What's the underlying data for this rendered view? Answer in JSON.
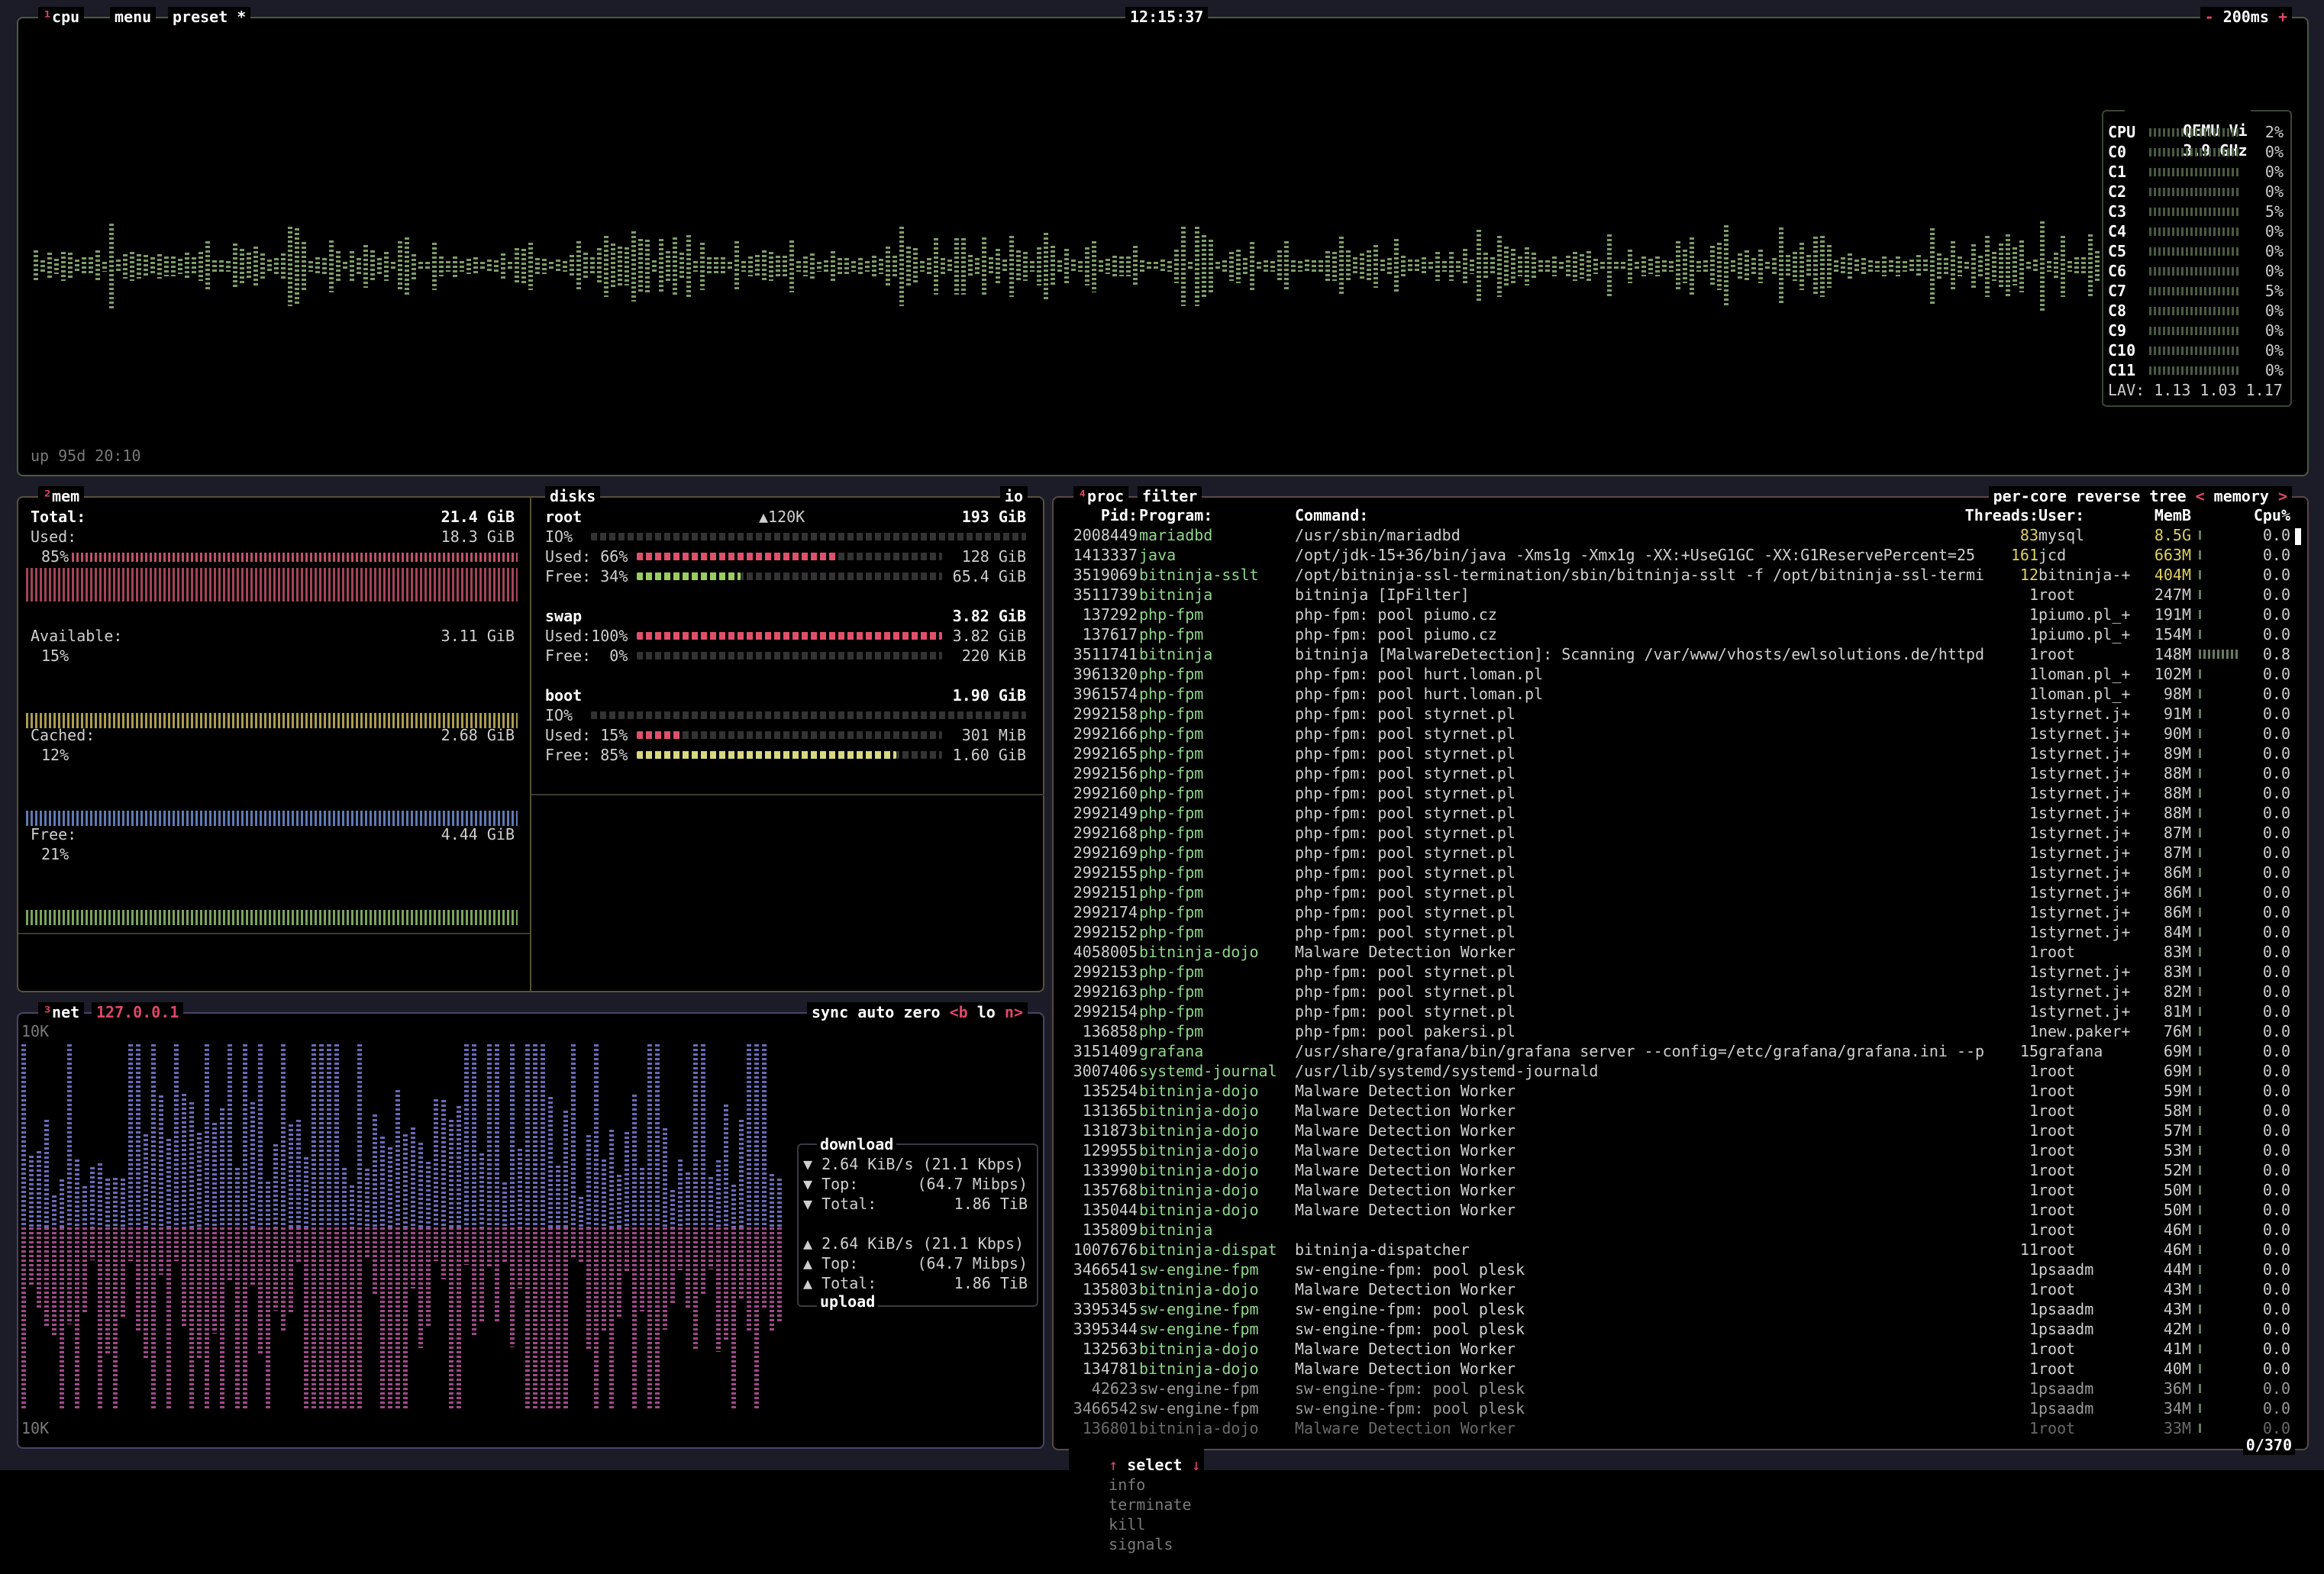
{
  "cpu": {
    "title_prefix": "¹",
    "title": "cpu",
    "menu": "menu",
    "preset": "preset *",
    "time": "12:15:37",
    "interval": "200ms",
    "minus": "-",
    "plus": "+",
    "uptime": "up 95d 20:10",
    "model": "QEMU Vi",
    "freq": "3.9 GHz",
    "total_label": "CPU",
    "total_pct": "2%",
    "cores": [
      {
        "label": "C0",
        "pct": "0%"
      },
      {
        "label": "C1",
        "pct": "0%"
      },
      {
        "label": "C2",
        "pct": "0%"
      },
      {
        "label": "C3",
        "pct": "5%"
      },
      {
        "label": "C4",
        "pct": "0%"
      },
      {
        "label": "C5",
        "pct": "0%"
      },
      {
        "label": "C6",
        "pct": "0%"
      },
      {
        "label": "C7",
        "pct": "5%"
      },
      {
        "label": "C8",
        "pct": "0%"
      },
      {
        "label": "C9",
        "pct": "0%"
      },
      {
        "label": "C10",
        "pct": "0%"
      },
      {
        "label": "C11",
        "pct": "0%"
      }
    ],
    "lav": "LAV: 1.13 1.03 1.17"
  },
  "mem": {
    "title_prefix": "²",
    "title": "mem",
    "total_label": "Total:",
    "total": "21.4 GiB",
    "used_label": "Used:",
    "used": "18.3 GiB",
    "used_pct": "85%",
    "avail_label": "Available:",
    "avail": "3.11 GiB",
    "avail_pct": "15%",
    "cached_label": "Cached:",
    "cached": "2.68 GiB",
    "cached_pct": "12%",
    "free_label": "Free:",
    "free": "4.44 GiB",
    "free_pct": "21%"
  },
  "disks": {
    "title": "disks",
    "io": "io",
    "root": {
      "name": "root",
      "speed": "▲120K",
      "size": "193 GiB",
      "io": "IO%",
      "used_label": "Used: 66%",
      "used": "128 GiB",
      "used_frac": 0.66,
      "free_label": "Free: 34%",
      "free": "65.4 GiB",
      "free_frac": 0.34
    },
    "swap": {
      "name": "swap",
      "size": "3.82 GiB",
      "used_label": "Used:100%",
      "used": "3.82 GiB",
      "used_frac": 1.0,
      "free_label": "Free:  0%",
      "free": "220 KiB",
      "free_frac": 0.0
    },
    "boot": {
      "name": "boot",
      "size": "1.90 GiB",
      "io": "IO%",
      "used_label": "Used: 15%",
      "used": "301 MiB",
      "used_frac": 0.15,
      "free_label": "Free: 85%",
      "free": "1.60 GiB",
      "free_frac": 0.85
    }
  },
  "net": {
    "title_prefix": "³",
    "title": "net",
    "iface": "127.0.0.1",
    "sync": "sync",
    "auto": "auto",
    "zero": "zero",
    "b": "<b",
    "lo": "lo",
    "n": "n>",
    "scale_top": "10K",
    "scale_bottom": "10K",
    "download_label": "download",
    "dl_rate": "2.64 KiB/s",
    "dl_rate_bits": "(21.1 Kbps)",
    "dl_top_label": "Top:",
    "dl_top": "(64.7 Mibps)",
    "dl_total_label": "Total:",
    "dl_total": "1.86 TiB",
    "ul_rate": "2.64 KiB/s",
    "ul_rate_bits": "(21.1 Kbps)",
    "ul_top_label": "Top:",
    "ul_top": "(64.7 Mibps)",
    "ul_total_label": "Total:",
    "ul_total": "1.86 TiB",
    "upload_label": "upload"
  },
  "proc": {
    "title_prefix": "⁴",
    "title": "proc",
    "filter": "filter",
    "per_core": "per-core",
    "reverse": "reverse",
    "tree": "tree",
    "sort": "memory",
    "headers": {
      "pid": "Pid:",
      "program": "Program:",
      "command": "Command:",
      "threads": "Threads:",
      "user": "User:",
      "memb": "MemB",
      "cpu": "Cpu%"
    },
    "footer_select": "select",
    "footer_info": "info",
    "footer_terminate": "terminate",
    "footer_kill": "kill",
    "footer_signals": "signals",
    "count": "0/370",
    "rows": [
      {
        "pid": "2008449",
        "prog": "mariadbd",
        "cmd": "/usr/sbin/mariadbd",
        "thr": "83",
        "user": "mysql",
        "mem": "8.5G",
        "cpu": "0.0",
        "load": 0.02
      },
      {
        "pid": "1413337",
        "prog": "java",
        "cmd": "/opt/jdk-15+36/bin/java -Xms1g -Xmx1g -XX:+UseG1GC -XX:G1ReservePercent=25",
        "thr": "161",
        "user": "jcd",
        "mem": "663M",
        "cpu": "0.0",
        "load": 0.02
      },
      {
        "pid": "3519069",
        "prog": "bitninja-sslt",
        "cmd": "/opt/bitninja-ssl-termination/sbin/bitninja-sslt -f /opt/bitninja-ssl-termi",
        "thr": "12",
        "user": "bitninja-+",
        "mem": "404M",
        "cpu": "0.0",
        "load": 0.1
      },
      {
        "pid": "3511739",
        "prog": "bitninja",
        "cmd": "bitninja [IpFilter]",
        "thr": "1",
        "user": "root",
        "mem": "247M",
        "cpu": "0.0",
        "load": 0.02
      },
      {
        "pid": "137292",
        "prog": "php-fpm",
        "cmd": "php-fpm: pool piumo.cz",
        "thr": "1",
        "user": "piumo.pl_+",
        "mem": "191M",
        "cpu": "0.0",
        "load": 0.02
      },
      {
        "pid": "137617",
        "prog": "php-fpm",
        "cmd": "php-fpm: pool piumo.cz",
        "thr": "1",
        "user": "piumo.pl_+",
        "mem": "154M",
        "cpu": "0.0",
        "load": 0.02
      },
      {
        "pid": "3511741",
        "prog": "bitninja",
        "cmd": "bitninja [MalwareDetection]: Scanning /var/www/vhosts/ewlsolutions.de/httpd",
        "thr": "1",
        "user": "root",
        "mem": "148M",
        "cpu": "0.8",
        "load": 0.9
      },
      {
        "pid": "3961320",
        "prog": "php-fpm",
        "cmd": "php-fpm: pool hurt.loman.pl",
        "thr": "1",
        "user": "loman.pl_+",
        "mem": "102M",
        "cpu": "0.0",
        "load": 0.02
      },
      {
        "pid": "3961574",
        "prog": "php-fpm",
        "cmd": "php-fpm: pool hurt.loman.pl",
        "thr": "1",
        "user": "loman.pl_+",
        "mem": "98M",
        "cpu": "0.0",
        "load": 0.02
      },
      {
        "pid": "2992158",
        "prog": "php-fpm",
        "cmd": "php-fpm: pool styrnet.pl",
        "thr": "1",
        "user": "styrnet.j+",
        "mem": "91M",
        "cpu": "0.0",
        "load": 0.02
      },
      {
        "pid": "2992166",
        "prog": "php-fpm",
        "cmd": "php-fpm: pool styrnet.pl",
        "thr": "1",
        "user": "styrnet.j+",
        "mem": "90M",
        "cpu": "0.0",
        "load": 0.02
      },
      {
        "pid": "2992165",
        "prog": "php-fpm",
        "cmd": "php-fpm: pool styrnet.pl",
        "thr": "1",
        "user": "styrnet.j+",
        "mem": "89M",
        "cpu": "0.0",
        "load": 0.02
      },
      {
        "pid": "2992156",
        "prog": "php-fpm",
        "cmd": "php-fpm: pool styrnet.pl",
        "thr": "1",
        "user": "styrnet.j+",
        "mem": "88M",
        "cpu": "0.0",
        "load": 0.02
      },
      {
        "pid": "2992160",
        "prog": "php-fpm",
        "cmd": "php-fpm: pool styrnet.pl",
        "thr": "1",
        "user": "styrnet.j+",
        "mem": "88M",
        "cpu": "0.0",
        "load": 0.02
      },
      {
        "pid": "2992149",
        "prog": "php-fpm",
        "cmd": "php-fpm: pool styrnet.pl",
        "thr": "1",
        "user": "styrnet.j+",
        "mem": "88M",
        "cpu": "0.0",
        "load": 0.02
      },
      {
        "pid": "2992168",
        "prog": "php-fpm",
        "cmd": "php-fpm: pool styrnet.pl",
        "thr": "1",
        "user": "styrnet.j+",
        "mem": "87M",
        "cpu": "0.0",
        "load": 0.02
      },
      {
        "pid": "2992169",
        "prog": "php-fpm",
        "cmd": "php-fpm: pool styrnet.pl",
        "thr": "1",
        "user": "styrnet.j+",
        "mem": "87M",
        "cpu": "0.0",
        "load": 0.02
      },
      {
        "pid": "2992155",
        "prog": "php-fpm",
        "cmd": "php-fpm: pool styrnet.pl",
        "thr": "1",
        "user": "styrnet.j+",
        "mem": "86M",
        "cpu": "0.0",
        "load": 0.02
      },
      {
        "pid": "2992151",
        "prog": "php-fpm",
        "cmd": "php-fpm: pool styrnet.pl",
        "thr": "1",
        "user": "styrnet.j+",
        "mem": "86M",
        "cpu": "0.0",
        "load": 0.02
      },
      {
        "pid": "2992174",
        "prog": "php-fpm",
        "cmd": "php-fpm: pool styrnet.pl",
        "thr": "1",
        "user": "styrnet.j+",
        "mem": "86M",
        "cpu": "0.0",
        "load": 0.02
      },
      {
        "pid": "2992152",
        "prog": "php-fpm",
        "cmd": "php-fpm: pool styrnet.pl",
        "thr": "1",
        "user": "styrnet.j+",
        "mem": "84M",
        "cpu": "0.0",
        "load": 0.02
      },
      {
        "pid": "4058005",
        "prog": "bitninja-dojo",
        "cmd": "Malware Detection Worker",
        "thr": "1",
        "user": "root",
        "mem": "83M",
        "cpu": "0.0",
        "load": 0.02
      },
      {
        "pid": "2992153",
        "prog": "php-fpm",
        "cmd": "php-fpm: pool styrnet.pl",
        "thr": "1",
        "user": "styrnet.j+",
        "mem": "83M",
        "cpu": "0.0",
        "load": 0.02
      },
      {
        "pid": "2992163",
        "prog": "php-fpm",
        "cmd": "php-fpm: pool styrnet.pl",
        "thr": "1",
        "user": "styrnet.j+",
        "mem": "82M",
        "cpu": "0.0",
        "load": 0.02
      },
      {
        "pid": "2992154",
        "prog": "php-fpm",
        "cmd": "php-fpm: pool styrnet.pl",
        "thr": "1",
        "user": "styrnet.j+",
        "mem": "81M",
        "cpu": "0.0",
        "load": 0.02
      },
      {
        "pid": "136858",
        "prog": "php-fpm",
        "cmd": "php-fpm: pool pakersi.pl",
        "thr": "1",
        "user": "new.paker+",
        "mem": "76M",
        "cpu": "0.0",
        "load": 0.02
      },
      {
        "pid": "3151409",
        "prog": "grafana",
        "cmd": "/usr/share/grafana/bin/grafana server --config=/etc/grafana/grafana.ini --p",
        "thr": "15",
        "user": "grafana",
        "mem": "69M",
        "cpu": "0.0",
        "load": 0.02
      },
      {
        "pid": "3007406",
        "prog": "systemd-journal",
        "cmd": "/usr/lib/systemd/systemd-journald",
        "thr": "1",
        "user": "root",
        "mem": "69M",
        "cpu": "0.0",
        "load": 0.02
      },
      {
        "pid": "135254",
        "prog": "bitninja-dojo",
        "cmd": "Malware Detection Worker",
        "thr": "1",
        "user": "root",
        "mem": "59M",
        "cpu": "0.0",
        "load": 0.02
      },
      {
        "pid": "131365",
        "prog": "bitninja-dojo",
        "cmd": "Malware Detection Worker",
        "thr": "1",
        "user": "root",
        "mem": "58M",
        "cpu": "0.0",
        "load": 0.02
      },
      {
        "pid": "131873",
        "prog": "bitninja-dojo",
        "cmd": "Malware Detection Worker",
        "thr": "1",
        "user": "root",
        "mem": "57M",
        "cpu": "0.0",
        "load": 0.02
      },
      {
        "pid": "129955",
        "prog": "bitninja-dojo",
        "cmd": "Malware Detection Worker",
        "thr": "1",
        "user": "root",
        "mem": "53M",
        "cpu": "0.0",
        "load": 0.02
      },
      {
        "pid": "133990",
        "prog": "bitninja-dojo",
        "cmd": "Malware Detection Worker",
        "thr": "1",
        "user": "root",
        "mem": "52M",
        "cpu": "0.0",
        "load": 0.02
      },
      {
        "pid": "135768",
        "prog": "bitninja-dojo",
        "cmd": "Malware Detection Worker",
        "thr": "1",
        "user": "root",
        "mem": "50M",
        "cpu": "0.0",
        "load": 0.02
      },
      {
        "pid": "135044",
        "prog": "bitninja-dojo",
        "cmd": "Malware Detection Worker",
        "thr": "1",
        "user": "root",
        "mem": "50M",
        "cpu": "0.0",
        "load": 0.02
      },
      {
        "pid": "135809",
        "prog": "bitninja",
        "cmd": "",
        "thr": "1",
        "user": "root",
        "mem": "46M",
        "cpu": "0.0",
        "load": 0.02
      },
      {
        "pid": "1007676",
        "prog": "bitninja-dispat",
        "cmd": "bitninja-dispatcher",
        "thr": "11",
        "user": "root",
        "mem": "46M",
        "cpu": "0.0",
        "load": 0.02
      },
      {
        "pid": "3466541",
        "prog": "sw-engine-fpm",
        "cmd": "sw-engine-fpm: pool plesk",
        "thr": "1",
        "user": "psaadm",
        "mem": "44M",
        "cpu": "0.0",
        "load": 0.02
      },
      {
        "pid": "135803",
        "prog": "bitninja-dojo",
        "cmd": "Malware Detection Worker",
        "thr": "1",
        "user": "root",
        "mem": "43M",
        "cpu": "0.0",
        "load": 0.02
      },
      {
        "pid": "3395345",
        "prog": "sw-engine-fpm",
        "cmd": "sw-engine-fpm: pool plesk",
        "thr": "1",
        "user": "psaadm",
        "mem": "43M",
        "cpu": "0.0",
        "load": 0.02
      },
      {
        "pid": "3395344",
        "prog": "sw-engine-fpm",
        "cmd": "sw-engine-fpm: pool plesk",
        "thr": "1",
        "user": "psaadm",
        "mem": "42M",
        "cpu": "0.0",
        "load": 0.02
      },
      {
        "pid": "132563",
        "prog": "bitninja-dojo",
        "cmd": "Malware Detection Worker",
        "thr": "1",
        "user": "root",
        "mem": "41M",
        "cpu": "0.0",
        "load": 0.02
      },
      {
        "pid": "134781",
        "prog": "bitninja-dojo",
        "cmd": "Malware Detection Worker",
        "thr": "1",
        "user": "root",
        "mem": "40M",
        "cpu": "0.0",
        "load": 0.02
      },
      {
        "pid": "42623",
        "prog": "sw-engine-fpm",
        "cmd": "sw-engine-fpm: pool plesk",
        "thr": "1",
        "user": "psaadm",
        "mem": "36M",
        "cpu": "0.0",
        "load": 0.02
      },
      {
        "pid": "3466542",
        "prog": "sw-engine-fpm",
        "cmd": "sw-engine-fpm: pool plesk",
        "thr": "1",
        "user": "psaadm",
        "mem": "34M",
        "cpu": "0.0",
        "load": 0.02
      },
      {
        "pid": "136801",
        "prog": "bitninja-dojo",
        "cmd": "Malware Detection Worker",
        "thr": "1",
        "user": "root",
        "mem": "33M",
        "cpu": "0.0",
        "load": 0.02
      }
    ]
  }
}
